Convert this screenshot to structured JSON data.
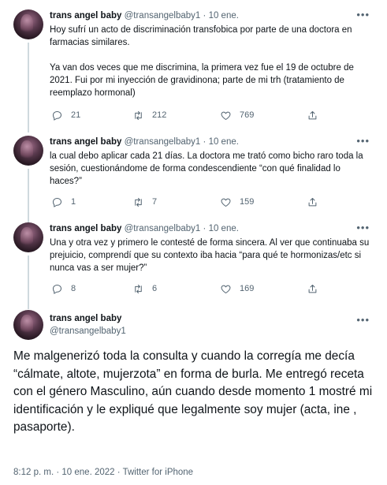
{
  "tweets": [
    {
      "name": "trans angel baby",
      "handle": "@transangelbaby1",
      "separator": "·",
      "date": "10 ene.",
      "text": "Hoy sufrí un acto de discriminación transfobica por parte de una doctora en farmacias similares.\n\nYa van dos veces que me discrimina, la primera vez fue el 19 de octubre de 2021. Fui por mi inyección de gravidinona; parte de mi trh (tratamiento de reemplazo hormonal)",
      "replies": "21",
      "retweets": "212",
      "likes": "769"
    },
    {
      "name": "trans angel baby",
      "handle": "@transangelbaby1",
      "separator": "·",
      "date": "10 ene.",
      "text": "la cual debo aplicar cada 21 días. La doctora me trató como bicho raro toda la sesión, cuestionándome de forma condescendiente “con qué finalidad lo haces?”",
      "replies": "1",
      "retweets": "7",
      "likes": "159"
    },
    {
      "name": "trans angel baby",
      "handle": "@transangelbaby1",
      "separator": "·",
      "date": "10 ene.",
      "text": "Una y otra vez y primero le contesté de forma sincera. Al ver que continuaba su prejuicio, comprendí que su contexto iba hacia “para qué te hormonizas/etc si nunca vas a ser mujer?”",
      "replies": "8",
      "retweets": "6",
      "likes": "169"
    }
  ],
  "main_tweet": {
    "name": "trans angel baby",
    "handle": "@transangelbaby1",
    "text": "Me malgenerizó toda la consulta y cuando la corregía me decía “cálmate, altote, mujerzota” en forma de burla. Me entregó receta con el género Masculino, aún cuando desde momento 1 mostré mi identificación y le expliqué que legalmente soy mujer (acta, ine , pasaporte).",
    "time": "8:12 p. m.",
    "separator": "·",
    "date": "10 ene. 2022",
    "source": "Twitter for iPhone"
  },
  "icons": {
    "more": "more-horizontal-icon",
    "reply": "reply-icon",
    "retweet": "retweet-icon",
    "like": "heart-icon",
    "share": "share-icon",
    "avatar": "avatar"
  },
  "colors": {
    "text": "#0f1419",
    "secondary": "#536471",
    "thread_line": "#cfd9de"
  }
}
